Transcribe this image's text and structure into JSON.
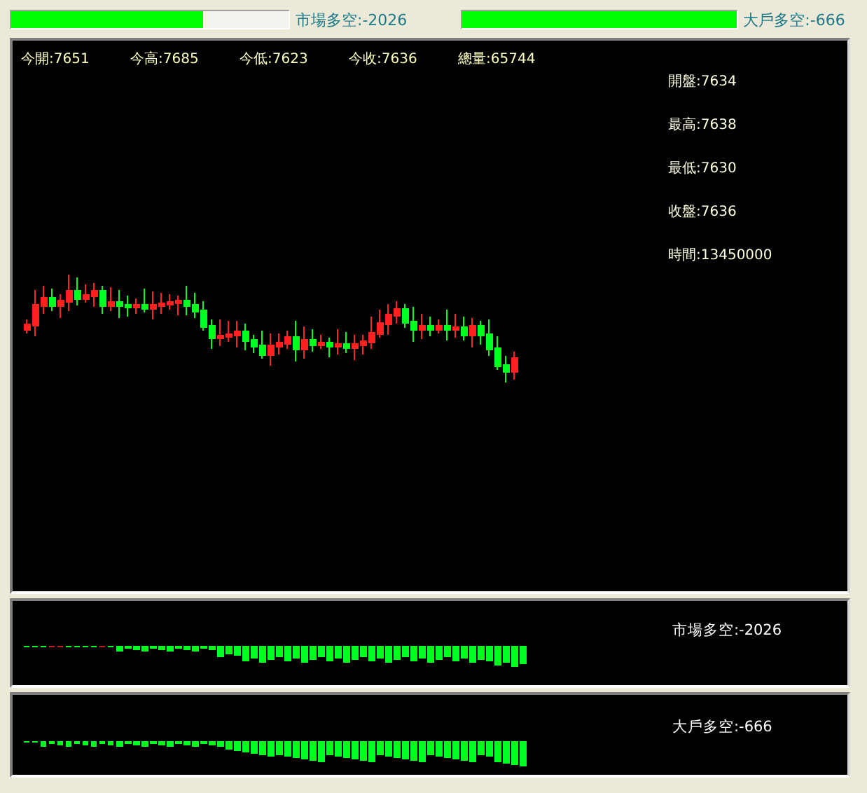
{
  "top_bars": [
    {
      "level": 0.69,
      "label": "市場多空:-2026"
    },
    {
      "level": 1.0,
      "label": "大戶多空:-666"
    }
  ],
  "main_chart": {
    "stats": [
      "今開:7651",
      "今高:7685",
      "今低:7623",
      "今收:7636",
      "總量:65744"
    ],
    "details": [
      "開盤:7634",
      "最高:7638",
      "最低:7630",
      "收盤:7636",
      "時間:13450000"
    ]
  },
  "sub_charts": [
    {
      "label": "市場多空:-2026"
    },
    {
      "label": "大戶多空:-666"
    }
  ]
}
